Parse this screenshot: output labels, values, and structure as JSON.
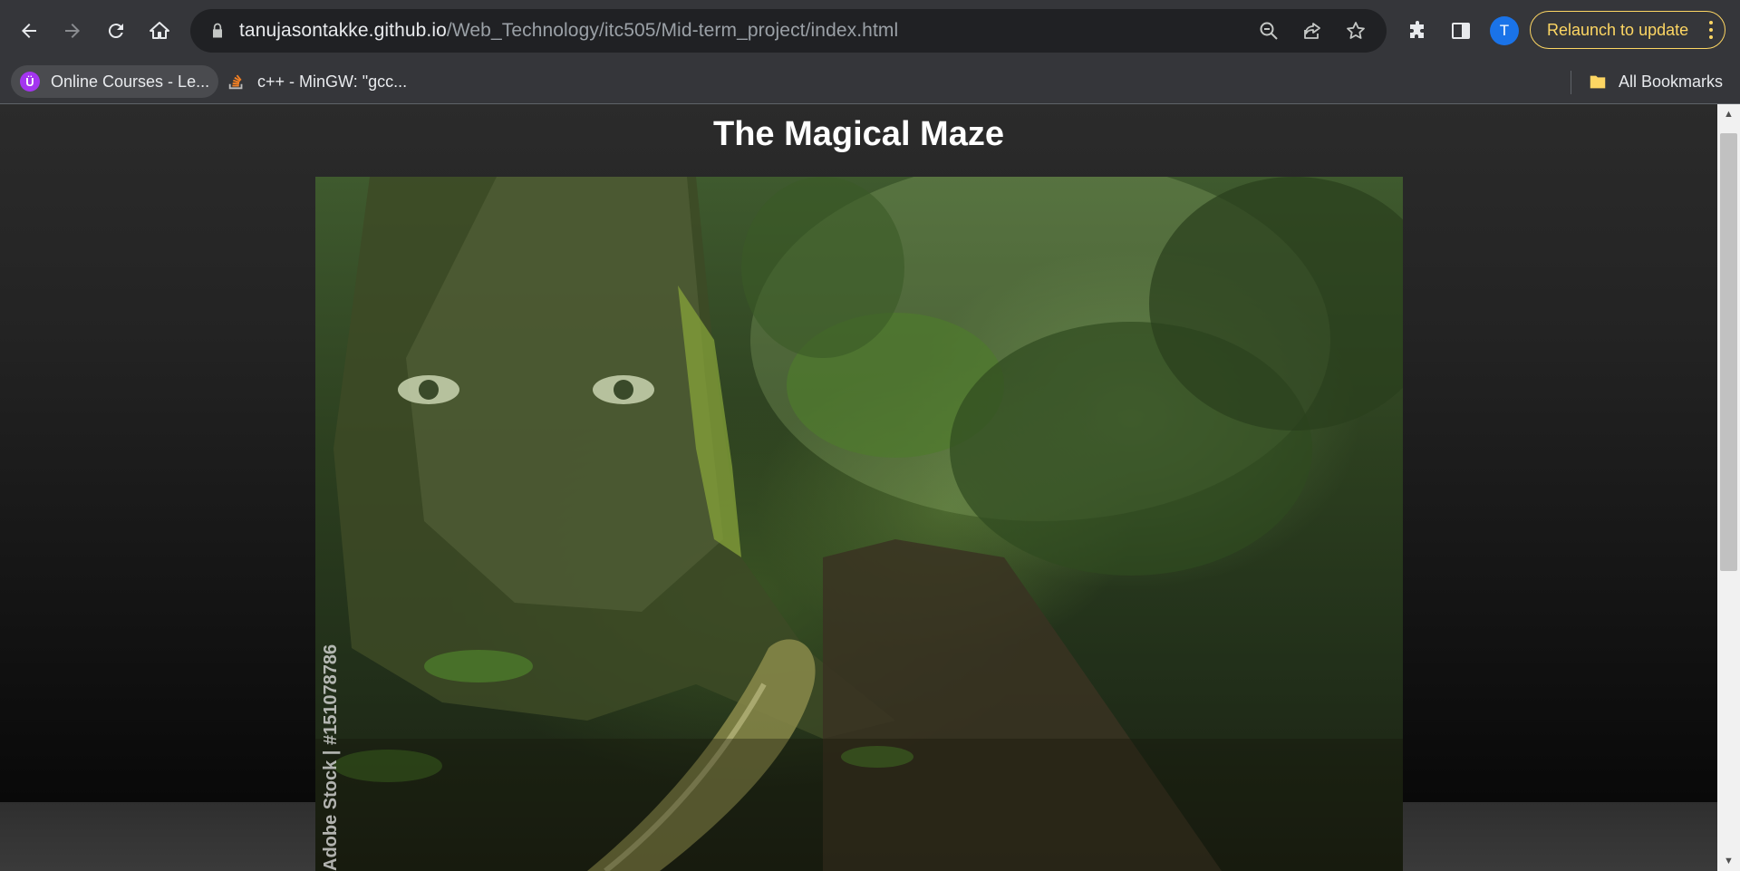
{
  "browser": {
    "url_host": "tanujasontakke.github.io",
    "url_path": "/Web_Technology/itc505/Mid-term_project/index.html",
    "relaunch_label": "Relaunch to update",
    "avatar_letter": "T",
    "accent_color": "#fdd663"
  },
  "bookmarks": {
    "items": [
      {
        "label": "Online Courses - Le...",
        "icon": "udemy-icon"
      },
      {
        "label": "c++ - MinGW: \"gcc...",
        "icon": "stackoverflow-icon"
      }
    ],
    "all_bookmarks_label": "All Bookmarks"
  },
  "page": {
    "title": "The Magical Maze",
    "hero_image": {
      "description_icon": "forest-face-image",
      "watermark": "Adobe Stock | #151078786"
    }
  }
}
